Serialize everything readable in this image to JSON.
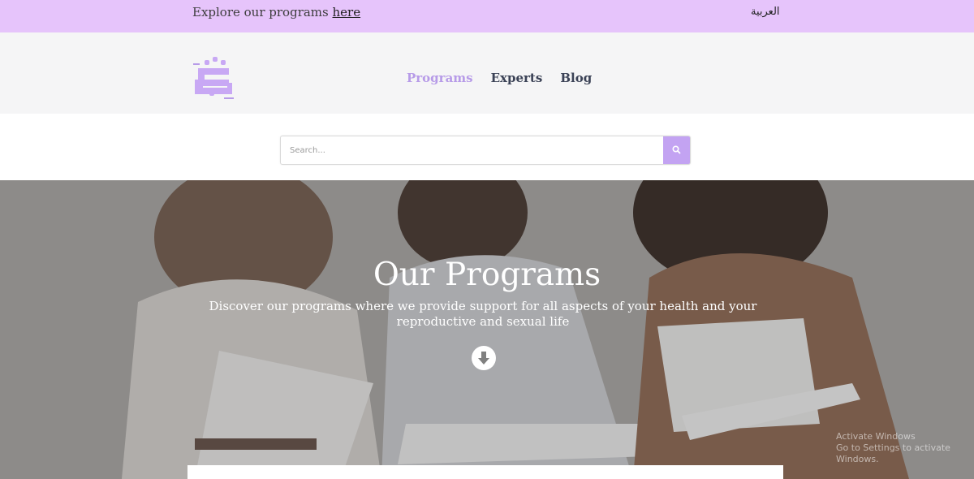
{
  "topbar": {
    "explore_text": "Explore our programs ",
    "explore_link": "here",
    "language": "العربية"
  },
  "header": {
    "logo": "metle-logo",
    "nav": [
      {
        "label": "Programs",
        "active": true
      },
      {
        "label": "Experts",
        "active": false
      },
      {
        "label": "Blog",
        "active": false
      }
    ]
  },
  "search": {
    "placeholder": "Search...",
    "value": "",
    "icon": "search-icon"
  },
  "hero": {
    "title": "Our Programs",
    "subtitle": "Discover our programs where we provide support for all aspects of your health and your reproductive and sexual life",
    "icon": "arrow-down-circle-icon"
  },
  "watermark": {
    "line1": "Activate Windows",
    "line2": "Go to Settings to activate Windows."
  },
  "colors": {
    "topbar_bg": "#e6c4fb",
    "accent": "#b79be8",
    "search_button": "#c3a3f2",
    "nav_text": "#3b4256"
  }
}
